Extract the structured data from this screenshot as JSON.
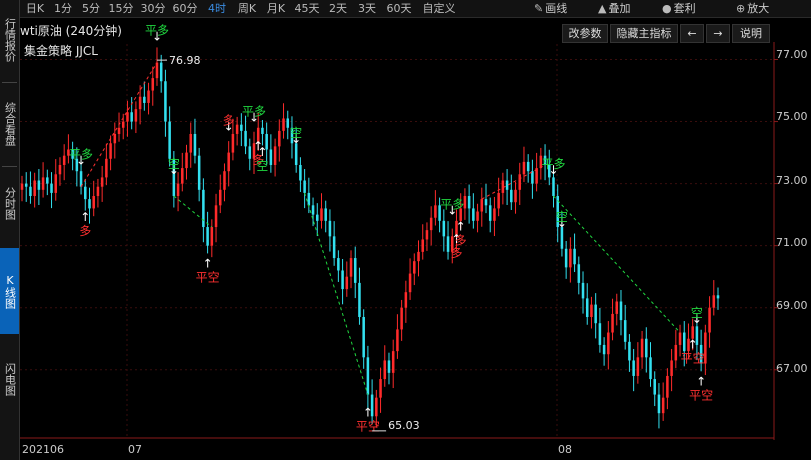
{
  "sidebar": {
    "items": [
      {
        "label": "行情报价",
        "active": false
      },
      {
        "label": "综合看盘",
        "active": false
      },
      {
        "label": "分时图",
        "active": false
      },
      {
        "label": "K线图",
        "active": true
      },
      {
        "label": "闪电图",
        "active": false
      }
    ]
  },
  "toolbar": {
    "periods": [
      "日K",
      "1分",
      "5分",
      "15分",
      "30分",
      "60分",
      "4时",
      "周K",
      "月K",
      "45天",
      "2天",
      "3天",
      "60天",
      "自定义"
    ],
    "active_period": "4时",
    "tools": [
      {
        "label": "画线",
        "icon": "pencil-icon"
      },
      {
        "label": "叠加",
        "icon": "overlay-icon"
      },
      {
        "label": "套利",
        "icon": "arbitrage-icon"
      },
      {
        "label": "放大",
        "icon": "zoom-icon"
      }
    ]
  },
  "chart_header": {
    "title": "wti原油 (240分钟)",
    "strategy": "集金策略 JJCL",
    "buttons": {
      "params": "改参数",
      "hide_indicator": "隐藏主指标",
      "explain": "说明",
      "prev": "←",
      "next": "→"
    }
  },
  "colors": {
    "up": "#ff2b2b",
    "down": "#33e0f0",
    "long": "#ff3030",
    "close_long": "#20d840",
    "short": "#20d840",
    "close_short": "#ff3030",
    "accent": "#0a63b8"
  },
  "chart_data": {
    "type": "candlestick",
    "symbol": "wti原油",
    "period": "240分钟",
    "y_ticks": [
      "77.00",
      "75.00",
      "73.00",
      "71.00",
      "69.00",
      "67.00"
    ],
    "ylim": [
      64.8,
      77.5
    ],
    "x_ticks": [
      "202106",
      "07",
      "08"
    ],
    "annotations": {
      "high": "76.98",
      "low": "65.03"
    },
    "closes": [
      73.0,
      72.9,
      72.6,
      73.1,
      72.8,
      73.2,
      73.0,
      72.7,
      73.3,
      73.6,
      73.9,
      74.1,
      73.8,
      73.4,
      72.9,
      72.5,
      72.2,
      72.6,
      72.9,
      73.2,
      73.8,
      74.3,
      74.6,
      74.8,
      75.0,
      75.3,
      75.0,
      75.4,
      75.8,
      75.6,
      76.0,
      76.4,
      76.9,
      76.3,
      75.0,
      73.8,
      72.6,
      73.0,
      73.5,
      74.0,
      74.6,
      73.9,
      72.8,
      71.6,
      71.0,
      71.6,
      72.3,
      72.8,
      73.4,
      74.0,
      74.6,
      74.9,
      74.7,
      74.2,
      73.8,
      74.3,
      74.8,
      74.6,
      74.1,
      73.6,
      74.2,
      74.7,
      75.1,
      74.8,
      74.3,
      73.6,
      73.1,
      72.7,
      72.3,
      72.0,
      71.8,
      72.2,
      71.8,
      71.3,
      70.6,
      70.2,
      69.6,
      70.0,
      70.6,
      69.8,
      68.7,
      67.4,
      66.2,
      65.5,
      66.1,
      66.7,
      67.3,
      66.9,
      67.6,
      68.3,
      69.0,
      69.5,
      70.1,
      70.5,
      70.8,
      71.2,
      71.5,
      71.9,
      72.3,
      71.8,
      71.3,
      70.8,
      71.3,
      71.8,
      72.2,
      72.6,
      72.2,
      71.8,
      72.1,
      72.5,
      72.3,
      71.8,
      72.2,
      72.7,
      73.1,
      72.8,
      72.4,
      72.8,
      73.3,
      73.7,
      73.4,
      73.0,
      73.5,
      73.9,
      73.6,
      73.2,
      72.6,
      71.6,
      70.9,
      70.3,
      70.9,
      70.4,
      69.8,
      69.3,
      68.7,
      69.1,
      68.5,
      67.8,
      67.5,
      68.2,
      68.8,
      69.2,
      68.6,
      67.9,
      67.3,
      66.8,
      67.4,
      68.0,
      67.4,
      66.7,
      66.2,
      65.6,
      66.1,
      66.8,
      67.3,
      67.8,
      68.2,
      67.6,
      68.0,
      68.4,
      67.8,
      67.2,
      68.2,
      69.0,
      69.4,
      69.3
    ]
  },
  "signals": {
    "long": "多",
    "short": "空",
    "close_long": "平多",
    "close_short": "平空"
  }
}
